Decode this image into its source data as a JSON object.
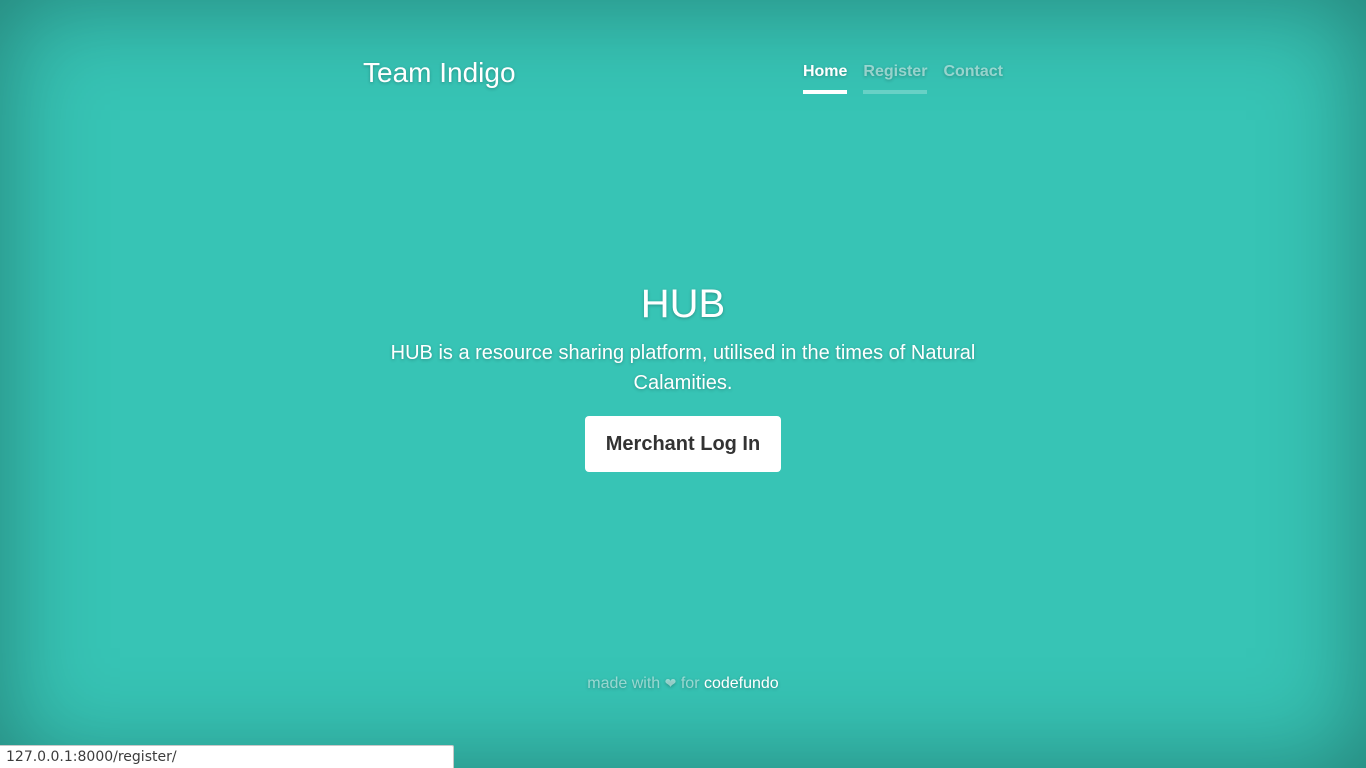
{
  "header": {
    "brand": "Team Indigo",
    "nav": [
      {
        "label": "Home",
        "state": "active"
      },
      {
        "label": "Register",
        "state": "hover"
      },
      {
        "label": "Contact",
        "state": "normal"
      }
    ]
  },
  "cover": {
    "heading": "HUB",
    "lead": "HUB is a resource sharing platform, utilised in the times of Natural Calamities.",
    "button_label": "Merchant Log In"
  },
  "footer": {
    "made_with": "made with",
    "heart": "❤",
    "for": "for",
    "link": "codefundo"
  },
  "status_bar": {
    "url": "127.0.0.1:8000/register/"
  },
  "colors": {
    "background": "#37c4b5",
    "button_text": "#333333"
  }
}
